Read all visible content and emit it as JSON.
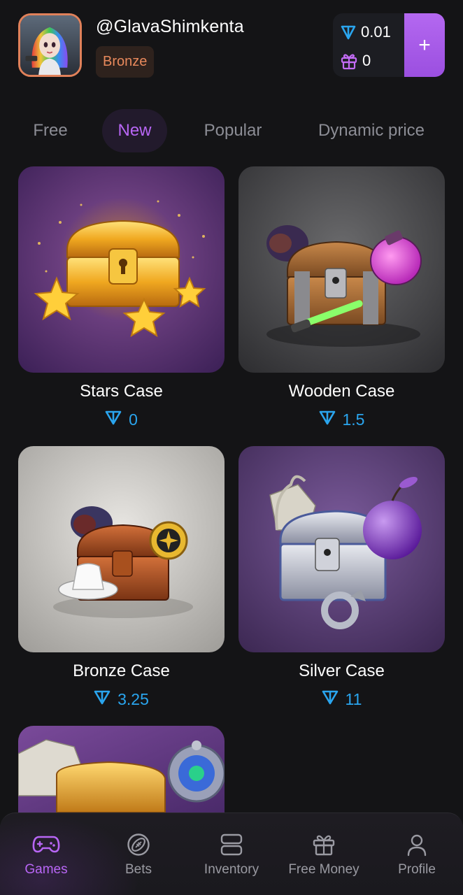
{
  "header": {
    "username": "@GlavaShimkenta",
    "rank": "Bronze",
    "ton_balance": "0.01",
    "gift_balance": "0",
    "add_label": "+"
  },
  "tabs": [
    {
      "label": "Free",
      "active": false
    },
    {
      "label": "New",
      "active": true
    },
    {
      "label": "Popular",
      "active": false
    },
    {
      "label": "Dynamic price",
      "active": false
    }
  ],
  "cases": [
    {
      "title": "Stars Case",
      "price": "0"
    },
    {
      "title": "Wooden Case",
      "price": "1.5"
    },
    {
      "title": "Bronze Case",
      "price": "3.25"
    },
    {
      "title": "Silver Case",
      "price": "11"
    },
    {
      "title": "",
      "price": ""
    }
  ],
  "nav": [
    {
      "label": "Games",
      "icon": "gamepad-icon",
      "active": true
    },
    {
      "label": "Bets",
      "icon": "football-icon",
      "active": false
    },
    {
      "label": "Inventory",
      "icon": "inventory-icon",
      "active": false
    },
    {
      "label": "Free Money",
      "icon": "gift-icon",
      "active": false
    },
    {
      "label": "Profile",
      "icon": "profile-icon",
      "active": false
    }
  ],
  "colors": {
    "background": "#141416",
    "accent": "#b866f5",
    "ton_blue": "#2aa5ee",
    "rank_orange": "#e8895c"
  }
}
